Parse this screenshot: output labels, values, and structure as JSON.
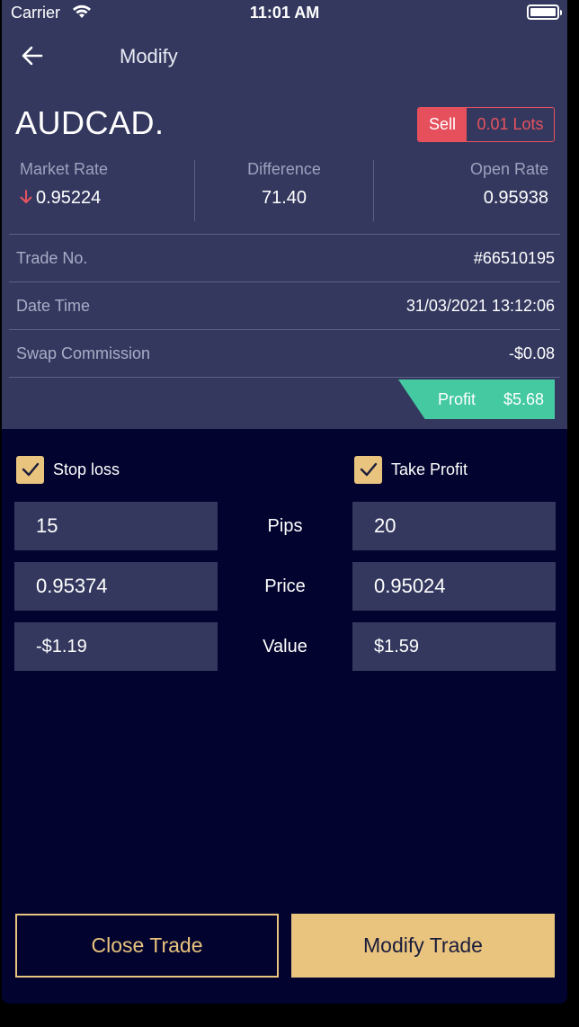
{
  "status_bar": {
    "carrier": "Carrier",
    "time": "11:01 AM"
  },
  "nav": {
    "title": "Modify",
    "back_icon": "arrow-left-icon"
  },
  "trade": {
    "symbol": "AUDCAD.",
    "direction": "Sell",
    "lots": "0.01 Lots",
    "market_rate": {
      "label": "Market Rate",
      "value": "0.95224",
      "trend_icon": "arrow-down-icon"
    },
    "difference": {
      "label": "Difference",
      "value": "71.40"
    },
    "open_rate": {
      "label": "Open Rate",
      "value": "0.95938"
    },
    "details": [
      {
        "label": "Trade No.",
        "value": "#66510195"
      },
      {
        "label": "Date Time",
        "value": "31/03/2021 13:12:06"
      },
      {
        "label": "Swap Commission",
        "value": "-$0.08"
      }
    ],
    "profit": {
      "label": "Profit",
      "value": "$5.68"
    }
  },
  "stop_loss": {
    "label": "Stop loss",
    "checked": true,
    "pips": "15",
    "price": "0.95374",
    "value": "-$1.19"
  },
  "take_profit": {
    "label": "Take Profit",
    "checked": true,
    "pips": "20",
    "price": "0.95024",
    "value": "$1.59"
  },
  "row_labels": {
    "pips": "Pips",
    "price": "Price",
    "value": "Value"
  },
  "buttons": {
    "close": "Close Trade",
    "modify": "Modify Trade"
  },
  "colors": {
    "accent": "#e9c47e",
    "sell": "#e64f5c",
    "profit": "#44c9a1",
    "panel": "#34385e",
    "background": "#02032e"
  }
}
